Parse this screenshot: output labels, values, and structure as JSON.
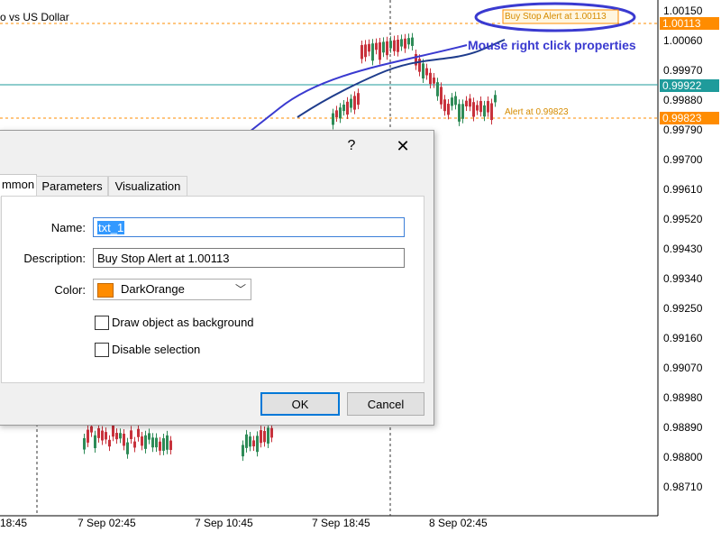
{
  "chart": {
    "symbol_title": "o vs US Dollar",
    "price_axis": [
      "1.00150",
      "1.00060",
      "0.99970",
      "0.99880",
      "0.99790",
      "0.99700",
      "0.99610",
      "0.99520",
      "0.99430",
      "0.99340",
      "0.99250",
      "0.99160",
      "0.99070",
      "0.98980",
      "0.98890",
      "0.98800",
      "0.98710"
    ],
    "price_tags": [
      {
        "value": "1.00113",
        "color": "#ff8c00"
      },
      {
        "value": "0.99922",
        "color": "#1f9b9b"
      },
      {
        "value": "0.99823",
        "color": "#ff8c00"
      }
    ],
    "time_axis": [
      "18:45",
      "7 Sep 02:45",
      "7 Sep 10:45",
      "7 Sep 18:45",
      "8 Sep 02:45"
    ],
    "alert_top_label": "Buy Stop Alert at 1.00113",
    "alert_low_label": "Alert at 0.99823",
    "annotation": "Mouse right click properties",
    "colors": {
      "bull": "#2e8b57",
      "bear": "#c8323c",
      "alert": "#ff8c00",
      "bid_line": "#1f9b9b",
      "annotation": "#3a3ad0"
    }
  },
  "dialog": {
    "help_icon": "?",
    "close_icon": "✕",
    "tabs": [
      "mmon",
      "Parameters",
      "Visualization"
    ],
    "name_label": "Name:",
    "name_value": "txt_1",
    "description_label": "Description:",
    "description_value": "Buy Stop Alert at 1.00113",
    "color_label": "Color:",
    "color_value": "DarkOrange",
    "color_hex": "#ff8c00",
    "draw_background_label": "Draw object as background",
    "draw_background_checked": false,
    "disable_selection_label": "Disable selection",
    "disable_selection_checked": false,
    "ok_label": "OK",
    "cancel_label": "Cancel"
  }
}
